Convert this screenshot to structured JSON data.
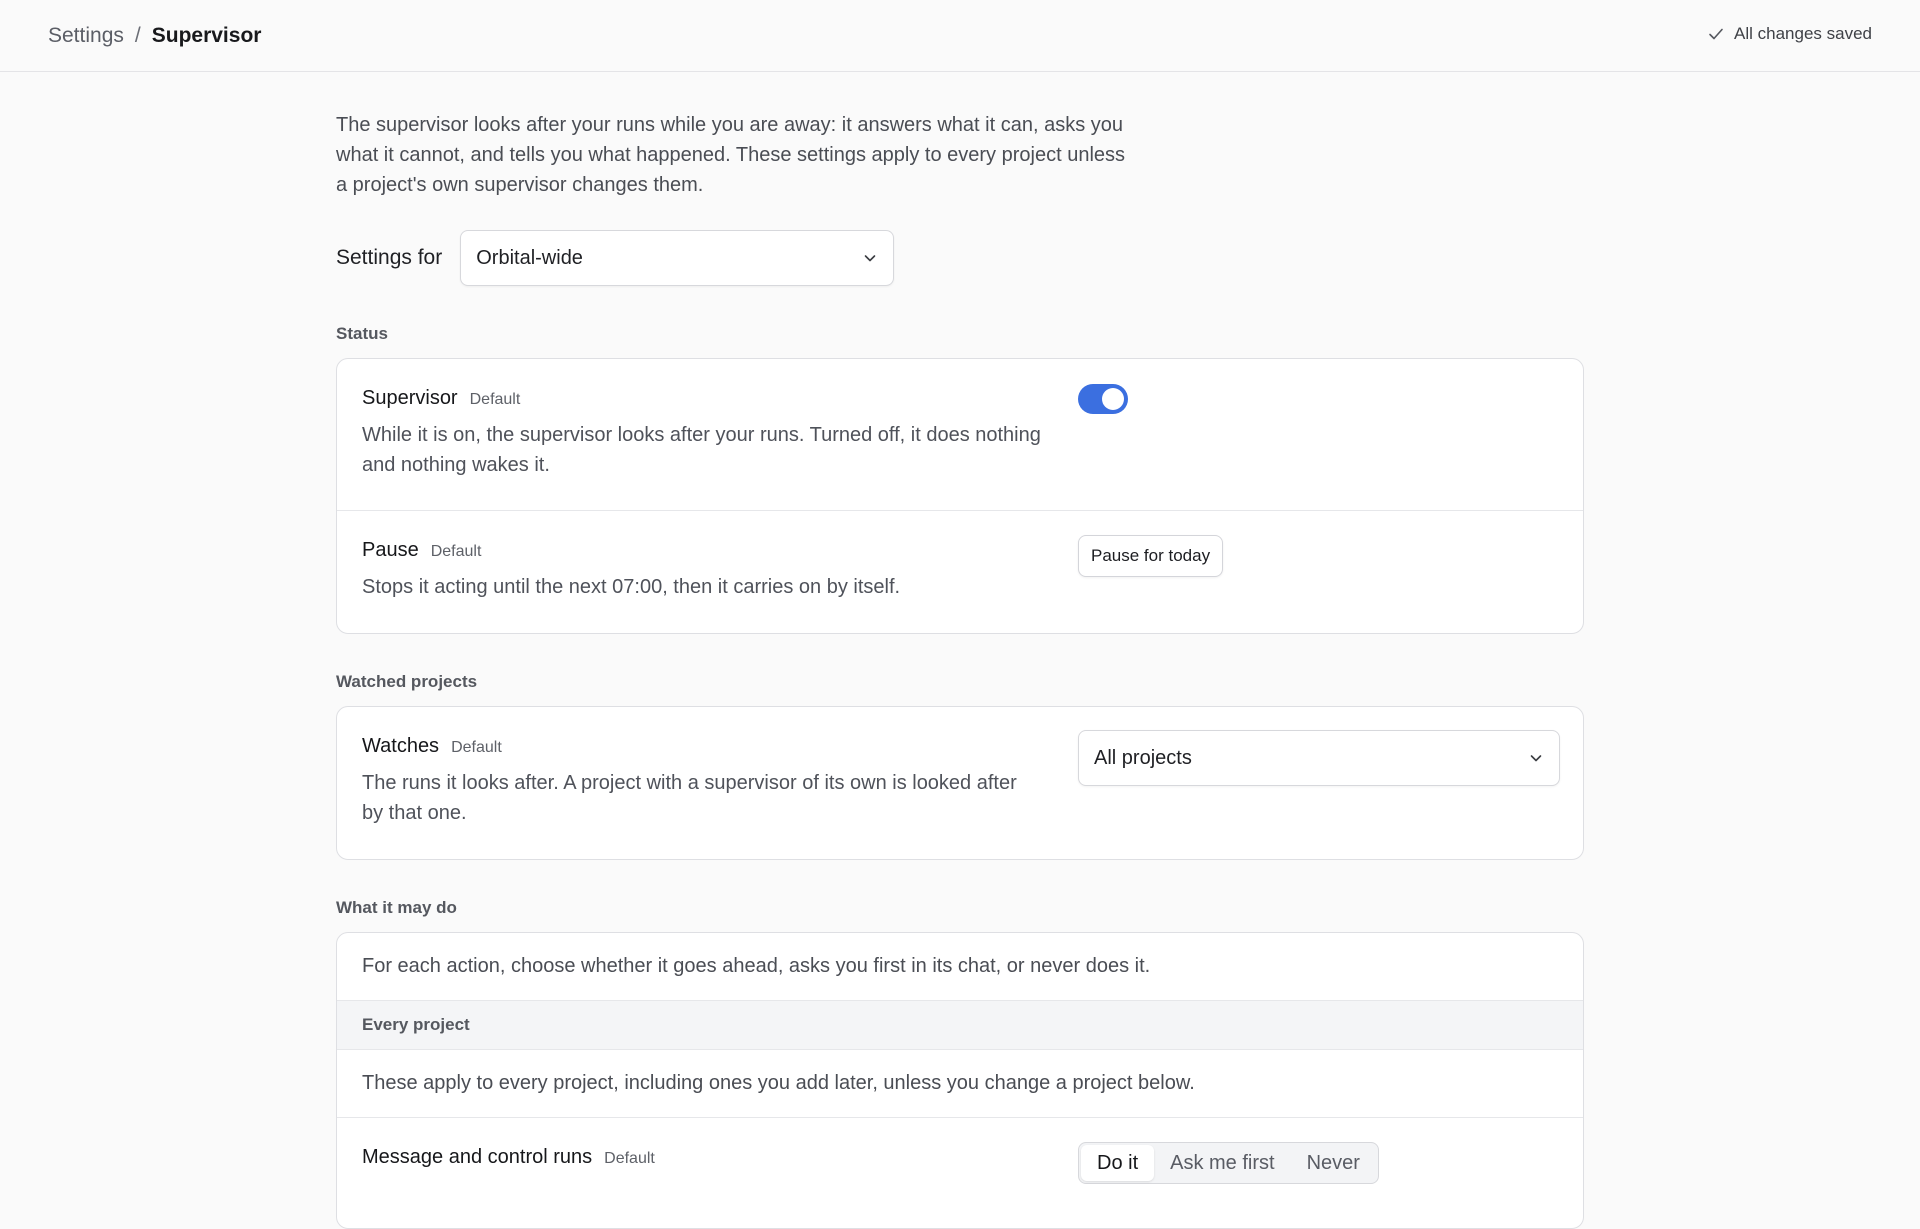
{
  "header": {
    "breadcrumb_parent": "Settings",
    "breadcrumb_separator": "/",
    "breadcrumb_current": "Supervisor",
    "save_status": "All changes saved"
  },
  "intro": "The supervisor looks after your runs while you are away: it answers what it can, asks you what it cannot, and tells you what happened. These settings apply to every project unless a project's own supervisor changes them.",
  "settings_for": {
    "label": "Settings for",
    "value": "Orbital-wide"
  },
  "status": {
    "section_title": "Status",
    "supervisor": {
      "name": "Supervisor",
      "tag": "Default",
      "description": "While it is on, the supervisor looks after your runs. Turned off, it does nothing and nothing wakes it.",
      "enabled": true
    },
    "pause": {
      "name": "Pause",
      "tag": "Default",
      "description": "Stops it acting until the next 07:00, then it carries on by itself.",
      "button_label": "Pause for today"
    }
  },
  "watched": {
    "section_title": "Watched projects",
    "watches": {
      "name": "Watches",
      "tag": "Default",
      "description": "The runs it looks after. A project with a supervisor of its own is looked after by that one.",
      "value": "All projects"
    }
  },
  "actions": {
    "section_title": "What it may do",
    "note": "For each action, choose whether it goes ahead, asks you first in its chat, or never does it.",
    "group_title": "Every project",
    "group_note": "These apply to every project, including ones you add later, unless you change a project below.",
    "message_control": {
      "name": "Message and control runs",
      "tag": "Default",
      "options": [
        "Do it",
        "Ask me first",
        "Never"
      ],
      "selected": "Do it"
    }
  },
  "colors": {
    "accent": "#3b6fe0",
    "background": "#fafafa"
  }
}
